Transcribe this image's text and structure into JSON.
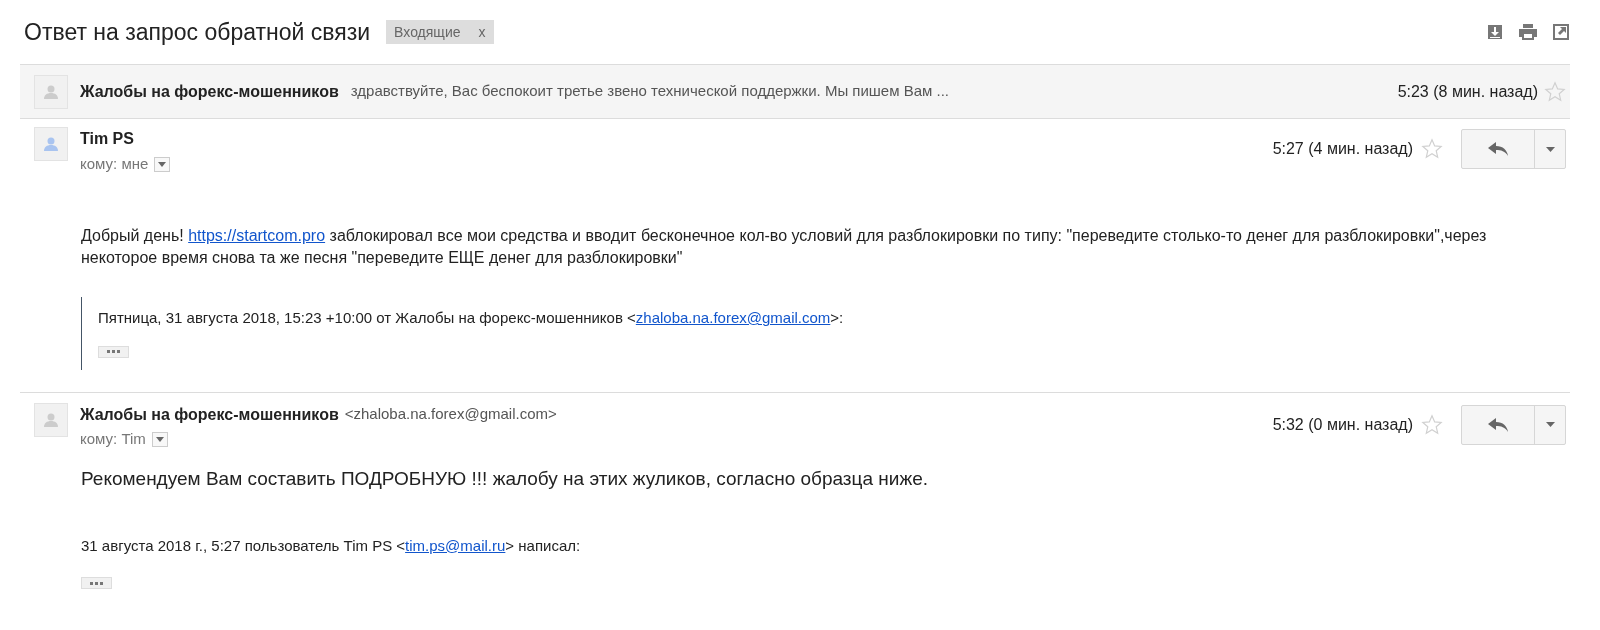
{
  "subject": "Ответ на запрос обратной связи",
  "label": {
    "text": "Входящие",
    "close": "x"
  },
  "collapsed": {
    "sender": "Жалобы на форекс-мошенников",
    "snippet": "здравствуйте, Вас беспокоит третье звено технической поддержки. Мы пишем Вам ...",
    "time": "5:23 (8 мин. назад)",
    "starred": false,
    "color": "#cccccc"
  },
  "messages": [
    {
      "sender": "Tim PS",
      "time": "5:27 (4 мин. назад)",
      "starred": false,
      "to": "кому: мне",
      "color": "#a9c4f0",
      "large": false,
      "body": [
        {
          "kind": "text",
          "text": "Добрый день! "
        },
        {
          "kind": "link",
          "text": "https://startcom.pro"
        },
        {
          "kind": "text",
          "text": " заблокировал все мои средства и вводит бесконечное кол-во условий для разблокировки по типу: \"переведите столько-то денег для разблокировки\",через некоторое время снова та же песня \"переведите ЕЩЕ денег для разблокировки\""
        }
      ],
      "quote": {
        "bar": true,
        "parts": [
          {
            "kind": "text",
            "text": "Пятница, 31 августа 2018, 15:23 +10:00 от Жалобы на форекс-мошенников <"
          },
          {
            "kind": "link",
            "text": "zhaloba.na.forex@gmail.com"
          },
          {
            "kind": "text",
            "text": ">:"
          }
        ]
      }
    },
    {
      "sender": "Жалобы на форекс-мошенников",
      "email": "<zhaloba.na.forex@gmail.com>",
      "time": "5:32 (0 мин. назад)",
      "starred": false,
      "to": "кому: Tim",
      "color": "#cccccc",
      "large": true,
      "body": [
        {
          "kind": "text",
          "text": "Рекомендуем Вам составить ПОДРОБНУЮ !!! жалобу на этих жуликов, согласно образца ниже."
        }
      ],
      "quote": {
        "bar": false,
        "parts": [
          {
            "kind": "text",
            "text": "31 августа 2018 г., 5:27 пользователь Tim PS <"
          },
          {
            "kind": "link",
            "text": "tim.ps@mail.ru"
          },
          {
            "kind": "text",
            "text": "> написал:"
          }
        ]
      }
    }
  ]
}
